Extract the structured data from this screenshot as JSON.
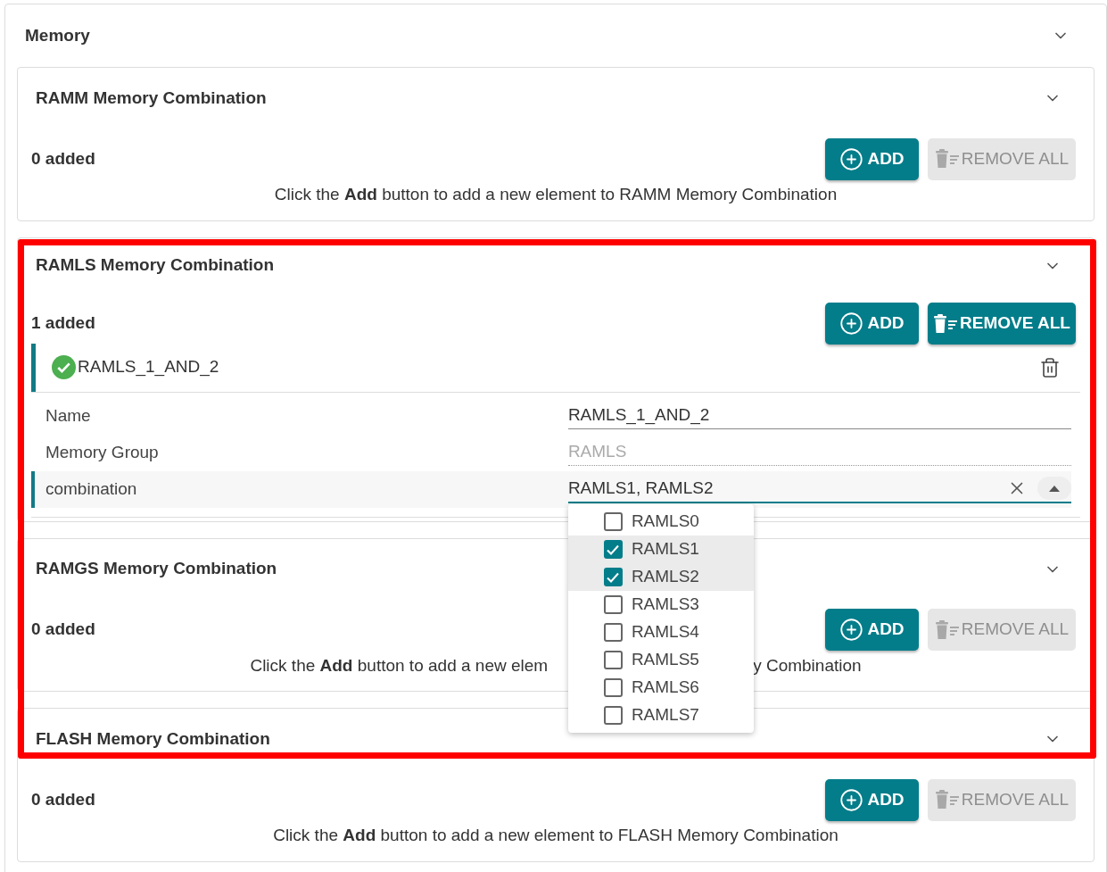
{
  "section": {
    "title": "Memory",
    "expanded": true
  },
  "groups": [
    {
      "title": "RAMM Memory Combination",
      "expanded": true,
      "count": "0 added",
      "add": "ADD",
      "remove_all": {
        "label": "REMOVE ALL",
        "disabled": true
      },
      "hint": [
        "Click the **Add** button to add a new element to RAMM Memory Combination"
      ]
    },
    {
      "title": "RAMLS Memory Combination",
      "expanded": true,
      "count": "1 added",
      "add": "ADD",
      "remove_all": {
        "label": "REMOVE ALL",
        "disabled": false
      },
      "items": [
        {
          "name": "RAMLS_1_AND_2",
          "valid": true,
          "fields": [
            {
              "kind": "text",
              "label": "Name",
              "value": "RAMLS_1_AND_2",
              "focused": false
            },
            {
              "kind": "readonly",
              "label": "Memory Group",
              "value": "RAMLS",
              "focused": false
            },
            {
              "kind": "multiselect",
              "label": "combination",
              "value": "RAMLS1, RAMLS2",
              "focused": true,
              "expanded": true,
              "options": [
                {
                  "label": "RAMLS0",
                  "checked": false
                },
                {
                  "label": "RAMLS1",
                  "checked": true
                },
                {
                  "label": "RAMLS2",
                  "checked": true
                },
                {
                  "label": "RAMLS3",
                  "checked": false
                },
                {
                  "label": "RAMLS4",
                  "checked": false
                },
                {
                  "label": "RAMLS5",
                  "checked": false
                },
                {
                  "label": "RAMLS6",
                  "checked": false
                },
                {
                  "label": "RAMLS7",
                  "checked": false
                }
              ]
            }
          ]
        }
      ]
    },
    {
      "title": "RAMGS Memory Combination",
      "expanded": true,
      "count": "0 added",
      "add": "ADD",
      "remove_all": {
        "label": "REMOVE ALL",
        "disabled": true
      },
      "hint": [
        "Click the **Add** button to add a new elem",
        "y Combination"
      ]
    },
    {
      "title": "FLASH Memory Combination",
      "expanded": true,
      "count": "0 added",
      "add": "ADD",
      "remove_all": {
        "label": "REMOVE ALL",
        "disabled": true
      },
      "hint": [
        "Click the **Add** button to add a new element to FLASH Memory Combination"
      ]
    }
  ],
  "annotation": {
    "kind": "frame"
  }
}
